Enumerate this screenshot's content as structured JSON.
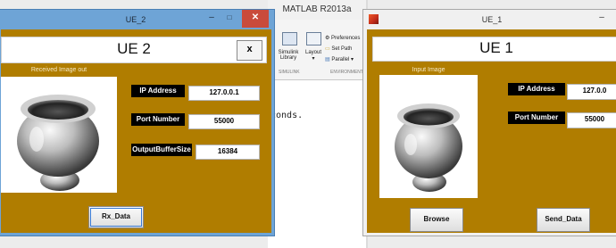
{
  "matlab": {
    "title": "MATLAB R2013a",
    "simulink_label_1": "Simulink",
    "simulink_label_2": "Library",
    "layout_label": "Layout",
    "preferences_label": "Preferences",
    "set_path_label": "Set Path",
    "parallel_label": "Parallel",
    "section_simulink": "SIMULINK",
    "section_environment": "ENVIRONMENT",
    "command_text": "conds."
  },
  "ue2": {
    "window_title": "UE_2",
    "heading": "UE 2",
    "close_label": "x",
    "image_caption": "Received Image out",
    "ip_label": "IP Address",
    "ip_value": "127.0.0.1",
    "port_label": "Port Number",
    "port_value": "55000",
    "buffer_label": "OutputBufferSize",
    "buffer_value": "16384",
    "rx_button": "Rx_Data"
  },
  "ue1": {
    "window_title": "UE_1",
    "heading": "UE 1",
    "image_caption": "Input Image",
    "ip_label": "IP Address",
    "ip_value": "127.0.0",
    "port_label": "Port Number",
    "port_value": "55000",
    "browse_button": "Browse",
    "send_button": "Send_Data"
  },
  "colors": {
    "panel_bg": "#b07d00",
    "ue2_frame": "#6ea4d6",
    "close_red": "#c94b3c"
  }
}
